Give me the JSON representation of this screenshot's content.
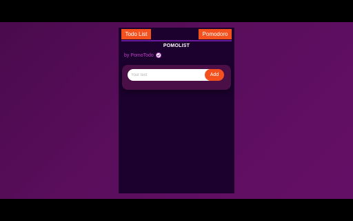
{
  "nav": {
    "todo_label": "Todo List",
    "pomodoro_label": "Pomodoro"
  },
  "app": {
    "title": "POMOLIST",
    "byline": "by PomoTodo"
  },
  "input": {
    "placeholder": "Your text",
    "value": ""
  },
  "add_label": "Add",
  "colors": {
    "accent": "#f4511e",
    "panel": "#1c002e",
    "card": "#4b0f48",
    "byline": "#c042c6",
    "background": "#5a0e5c"
  }
}
